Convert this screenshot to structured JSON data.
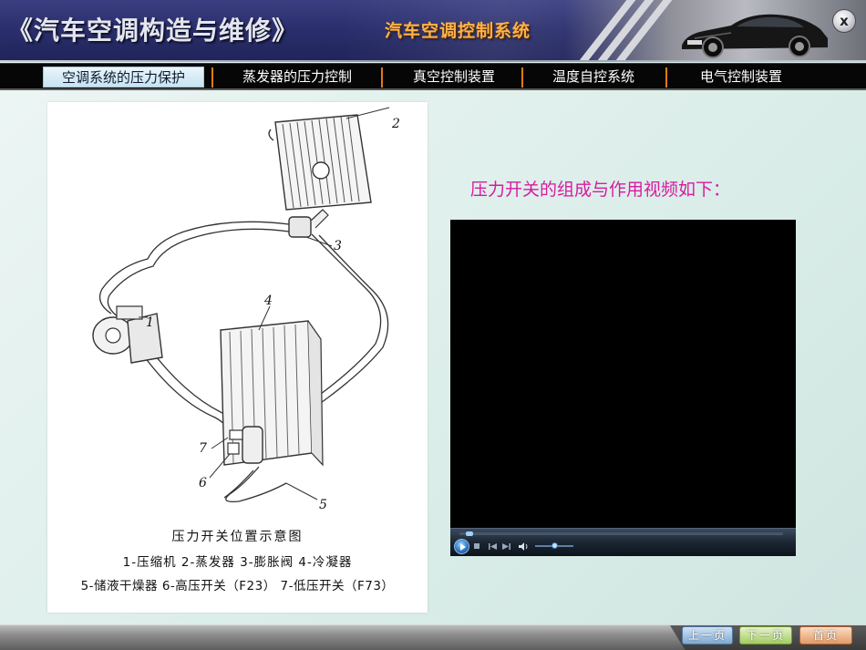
{
  "header": {
    "book_title": "《汽车空调构造与维修》",
    "chapter_title": "汽车空调控制系统",
    "close_label": "x"
  },
  "tabs": [
    {
      "label": "空调系统的压力保护",
      "active": true
    },
    {
      "label": "蒸发器的压力控制",
      "active": false
    },
    {
      "label": "真空控制装置",
      "active": false
    },
    {
      "label": "温度自控系统",
      "active": false
    },
    {
      "label": "电气控制装置",
      "active": false
    }
  ],
  "figure": {
    "callouts": [
      "1",
      "2",
      "3",
      "4",
      "5",
      "6",
      "7"
    ],
    "caption_title": "压力开关位置示意图",
    "caption_line1": "1-压缩机 2-蒸发器 3-膨胀阀 4-冷凝器",
    "caption_line2": "5-储液干燥器 6-高压开关（F23） 7-低压开关（F73）"
  },
  "video": {
    "caption": "压力开关的组成与作用视频如下：",
    "progress": 0.02,
    "volume": 0.5
  },
  "footer": {
    "prev_label": "上一页",
    "next_label": "下一页",
    "home_label": "首页"
  },
  "colors": {
    "header_bg": "#2b2f6d",
    "chapter_title": "#ffb24a",
    "tab_separator": "#e07a18",
    "video_caption": "#d81b9e"
  }
}
